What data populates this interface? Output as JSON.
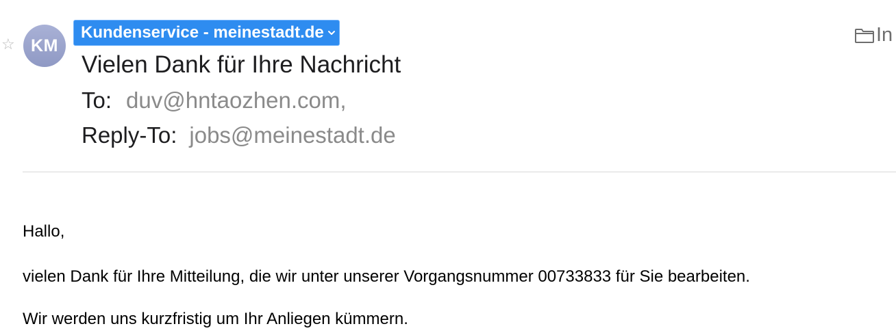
{
  "message": {
    "sender": {
      "display_name": "Kundenservice - meinestadt.de",
      "avatar_initials": "KM",
      "avatar_color": "#9aa3cf",
      "chip_color": "#2e8cf0"
    },
    "subject": "Vielen Dank für Ihre Nachricht",
    "to": {
      "label": "To:",
      "value": "duv@hntaozhen.com,"
    },
    "reply_to": {
      "label": "Reply-To:",
      "value": "jobs@meinestadt.de"
    },
    "mailbox": {
      "icon": "folder-icon",
      "label": "In"
    },
    "flag_icon": "star-icon"
  },
  "body": {
    "paragraphs": [
      "Hallo,",
      "vielen Dank für Ihre Mitteilung, die wir unter unserer Vorgangsnummer 00733833 für Sie bearbeiten.",
      "Wir werden uns kurzfristig um Ihr Anliegen kümmern."
    ]
  }
}
